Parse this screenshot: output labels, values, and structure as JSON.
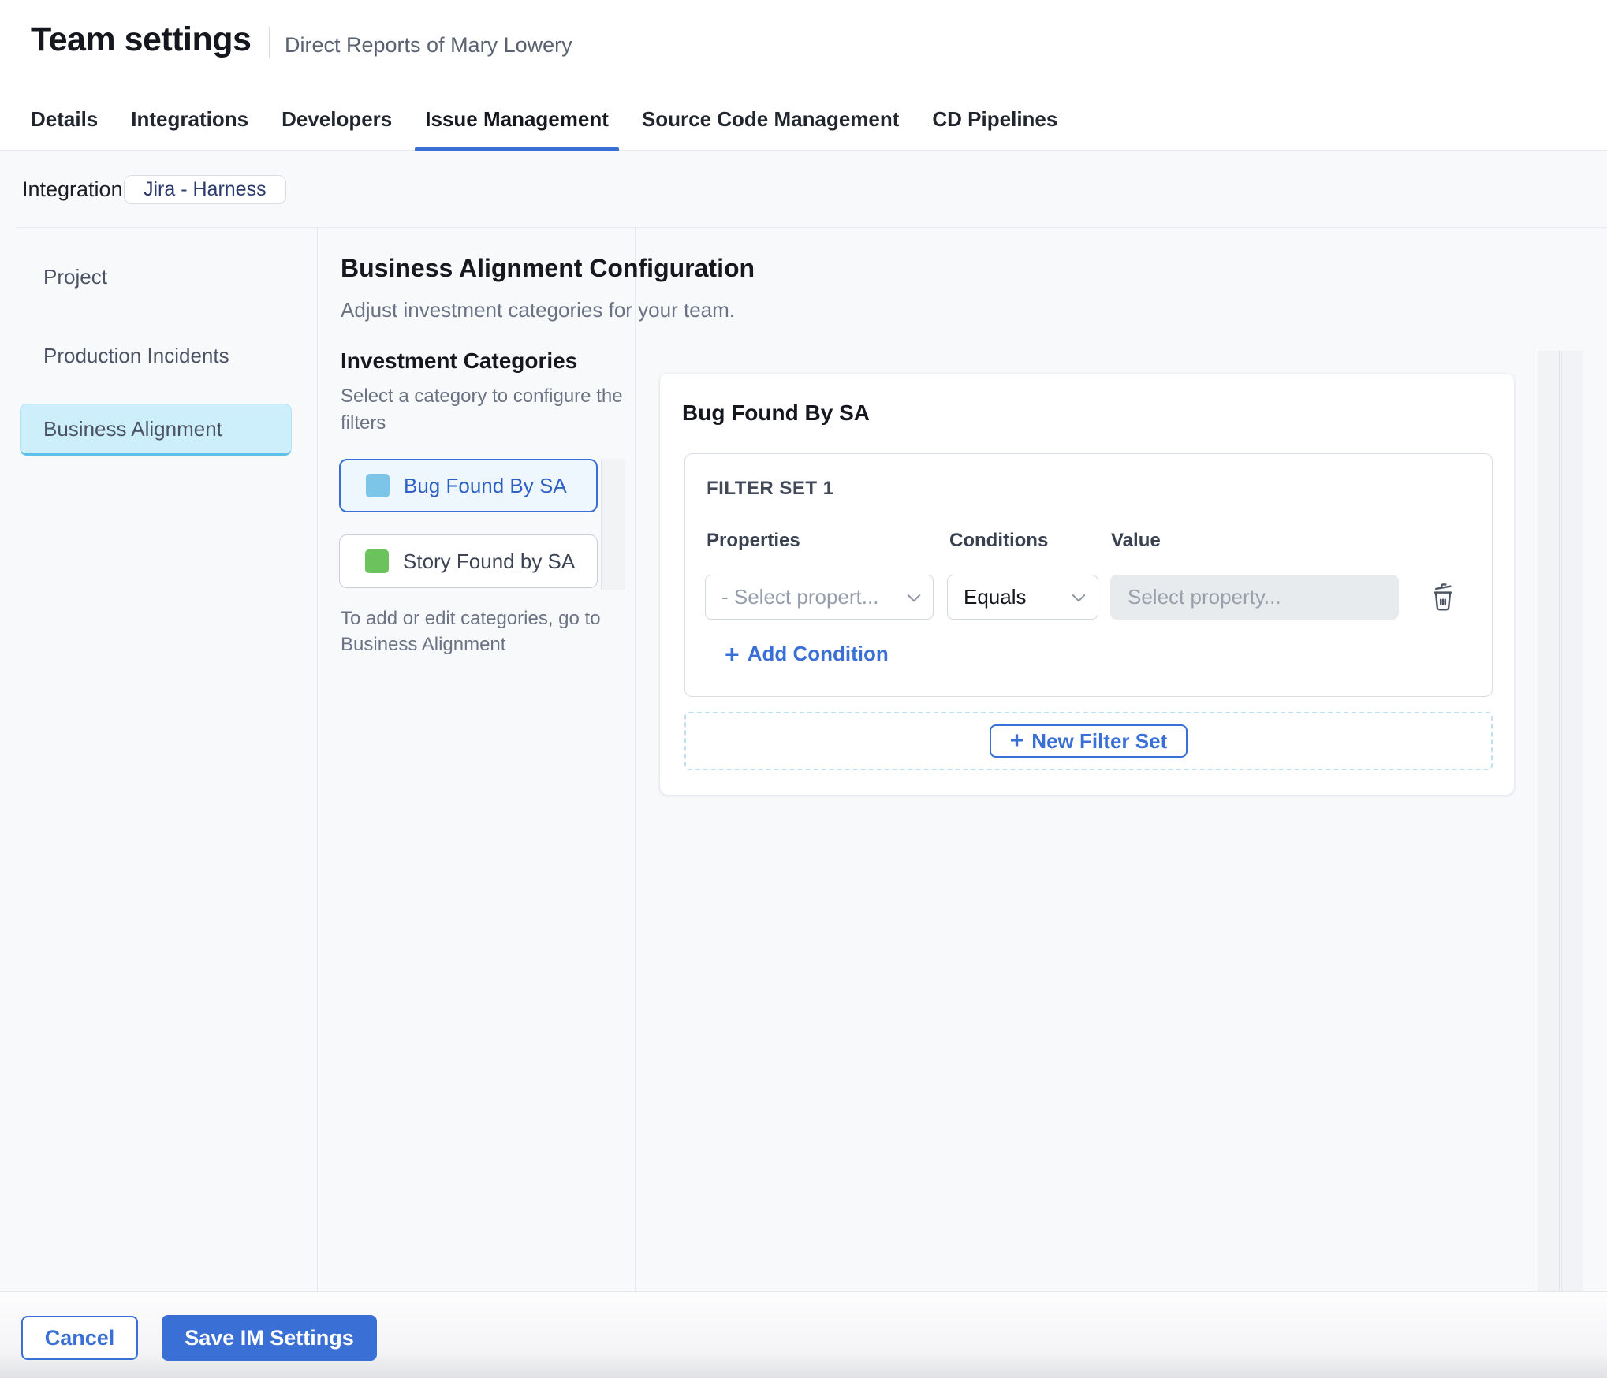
{
  "header": {
    "title": "Team settings",
    "subtitle": "Direct Reports of Mary Lowery"
  },
  "tabs": {
    "items": [
      {
        "label": "Details",
        "active": false
      },
      {
        "label": "Integrations",
        "active": false
      },
      {
        "label": "Developers",
        "active": false
      },
      {
        "label": "Issue Management",
        "active": true
      },
      {
        "label": "Source Code Management",
        "active": false
      },
      {
        "label": "CD Pipelines",
        "active": false
      }
    ]
  },
  "integration": {
    "label": "Integration:",
    "badge": "Jira - Harness"
  },
  "sidebar": {
    "items": [
      {
        "label": "Project",
        "selected": false
      },
      {
        "label": "Production Incidents",
        "selected": false
      },
      {
        "label": "Business Alignment",
        "selected": true
      }
    ]
  },
  "main": {
    "title": "Business Alignment Configuration",
    "subtitle": "Adjust investment categories for your team.",
    "categories": {
      "heading": "Investment Categories",
      "description": "Select a category to configure the filters",
      "items": [
        {
          "label": "Bug Found By SA",
          "swatch_color": "#7cc5e9",
          "selected": true
        },
        {
          "label": "Story Found by SA",
          "swatch_color": "#6cc25c",
          "selected": false
        }
      ],
      "note": "To add or edit categories, go to Business Alignment"
    },
    "panel": {
      "title": "Bug Found By SA",
      "filter_set": {
        "label": "FILTER SET 1",
        "columns": [
          "Properties",
          "Conditions",
          "Value"
        ],
        "property_placeholder": "- Select propert...",
        "condition_value": "Equals",
        "value_placeholder": "Select property...",
        "add_condition_label": "Add Condition"
      },
      "new_filter_set_label": "New Filter Set"
    }
  },
  "footer": {
    "cancel_label": "Cancel",
    "save_label": "Save IM Settings"
  },
  "colors": {
    "accent": "#3a70d6",
    "content-bg": "#f7f9fb",
    "badge-text": "#2b3a6e",
    "cat-bug": "#7cc5e9",
    "cat-story": "#6cc25c",
    "pill-bg": "#cdeefb"
  }
}
